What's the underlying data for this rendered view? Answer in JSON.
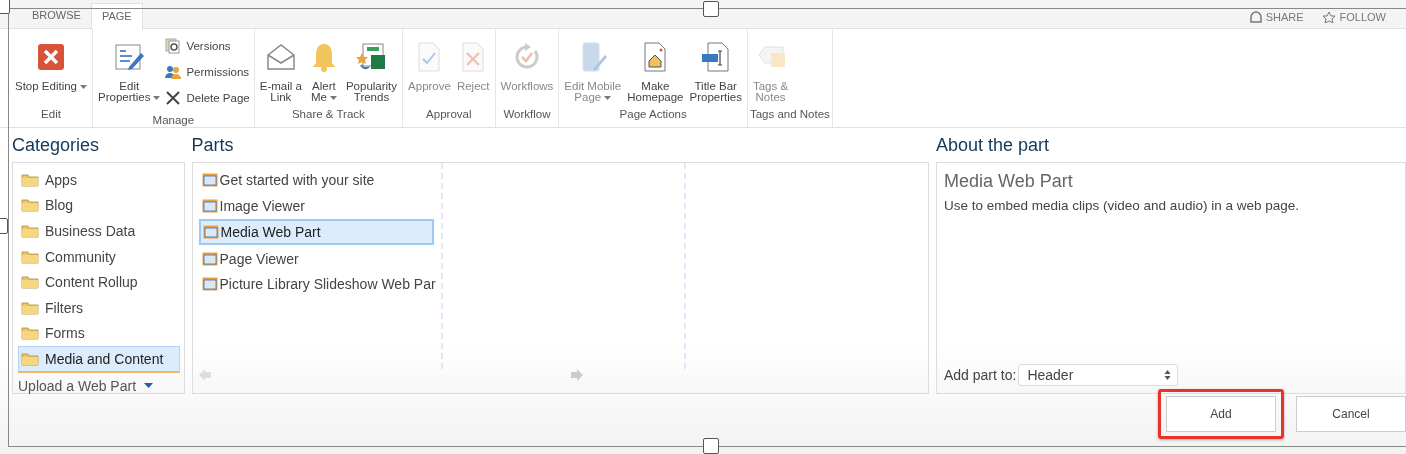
{
  "tabs": [
    {
      "label": "BROWSE",
      "selected": false
    },
    {
      "label": "PAGE",
      "selected": true
    }
  ],
  "top_actions": [
    {
      "label": "SHARE"
    },
    {
      "label": "FOLLOW"
    }
  ],
  "ribbon": {
    "groups": [
      {
        "label": "Edit",
        "commands": [
          {
            "kind": "large",
            "lines": [
              "Stop Editing"
            ],
            "dropdown": true,
            "disabled": false
          }
        ]
      },
      {
        "label": "Manage",
        "commands": [
          {
            "kind": "large",
            "lines": [
              "Edit",
              "Properties"
            ],
            "dropdown": true,
            "disabled": false
          },
          {
            "kind": "small",
            "lines": [
              "Versions"
            ],
            "dropdown": false,
            "disabled": false
          },
          {
            "kind": "small",
            "lines": [
              "Permissions"
            ],
            "dropdown": false,
            "disabled": false
          },
          {
            "kind": "small",
            "lines": [
              "Delete Page"
            ],
            "dropdown": false,
            "disabled": false
          }
        ]
      },
      {
        "label": "Share & Track",
        "commands": [
          {
            "kind": "large",
            "lines": [
              "E-mail a",
              "Link"
            ],
            "dropdown": false,
            "disabled": false
          },
          {
            "kind": "large",
            "lines": [
              "Alert",
              "Me"
            ],
            "dropdown": true,
            "disabled": false
          },
          {
            "kind": "large",
            "lines": [
              "Popularity",
              "Trends"
            ],
            "dropdown": false,
            "disabled": false
          }
        ]
      },
      {
        "label": "Approval",
        "commands": [
          {
            "kind": "large",
            "lines": [
              "Approve"
            ],
            "dropdown": false,
            "disabled": true
          },
          {
            "kind": "large",
            "lines": [
              "Reject"
            ],
            "dropdown": false,
            "disabled": true
          }
        ]
      },
      {
        "label": "Workflow",
        "commands": [
          {
            "kind": "large",
            "lines": [
              "Workflows"
            ],
            "dropdown": false,
            "disabled": true
          }
        ]
      },
      {
        "label": "Page Actions",
        "commands": [
          {
            "kind": "large",
            "lines": [
              "Edit Mobile",
              "Page"
            ],
            "dropdown": true,
            "disabled": true
          },
          {
            "kind": "large",
            "lines": [
              "Make",
              "Homepage"
            ],
            "dropdown": false,
            "disabled": false
          },
          {
            "kind": "large",
            "lines": [
              "Title Bar",
              "Properties"
            ],
            "dropdown": false,
            "disabled": false
          }
        ]
      },
      {
        "label": "Tags and Notes",
        "commands": [
          {
            "kind": "large",
            "lines": [
              "Tags &",
              "Notes"
            ],
            "dropdown": false,
            "disabled": true
          }
        ]
      }
    ]
  },
  "categories": {
    "title": "Categories",
    "items": [
      {
        "label": "Apps",
        "selected": false
      },
      {
        "label": "Blog",
        "selected": false
      },
      {
        "label": "Business Data",
        "selected": false
      },
      {
        "label": "Community",
        "selected": false
      },
      {
        "label": "Content Rollup",
        "selected": false
      },
      {
        "label": "Filters",
        "selected": false
      },
      {
        "label": "Forms",
        "selected": false
      },
      {
        "label": "Media and Content",
        "selected": true
      }
    ],
    "upload_link": "Upload a Web Part"
  },
  "parts": {
    "title": "Parts",
    "items": [
      {
        "label": "Get started with your site",
        "selected": false
      },
      {
        "label": "Image Viewer",
        "selected": false
      },
      {
        "label": "Media Web Part",
        "selected": true
      },
      {
        "label": "Page Viewer",
        "selected": false
      },
      {
        "label": "Picture Library Slideshow Web Par",
        "selected": false
      }
    ]
  },
  "about": {
    "title": "About the part",
    "part_name": "Media Web Part",
    "description": "Use to embed media clips (video and audio) in a web page.",
    "add_to_label": "Add part to:",
    "add_to_value": "Header"
  },
  "buttons": [
    {
      "label": "Add",
      "highlighted": true
    },
    {
      "label": "Cancel",
      "highlighted": false
    }
  ]
}
